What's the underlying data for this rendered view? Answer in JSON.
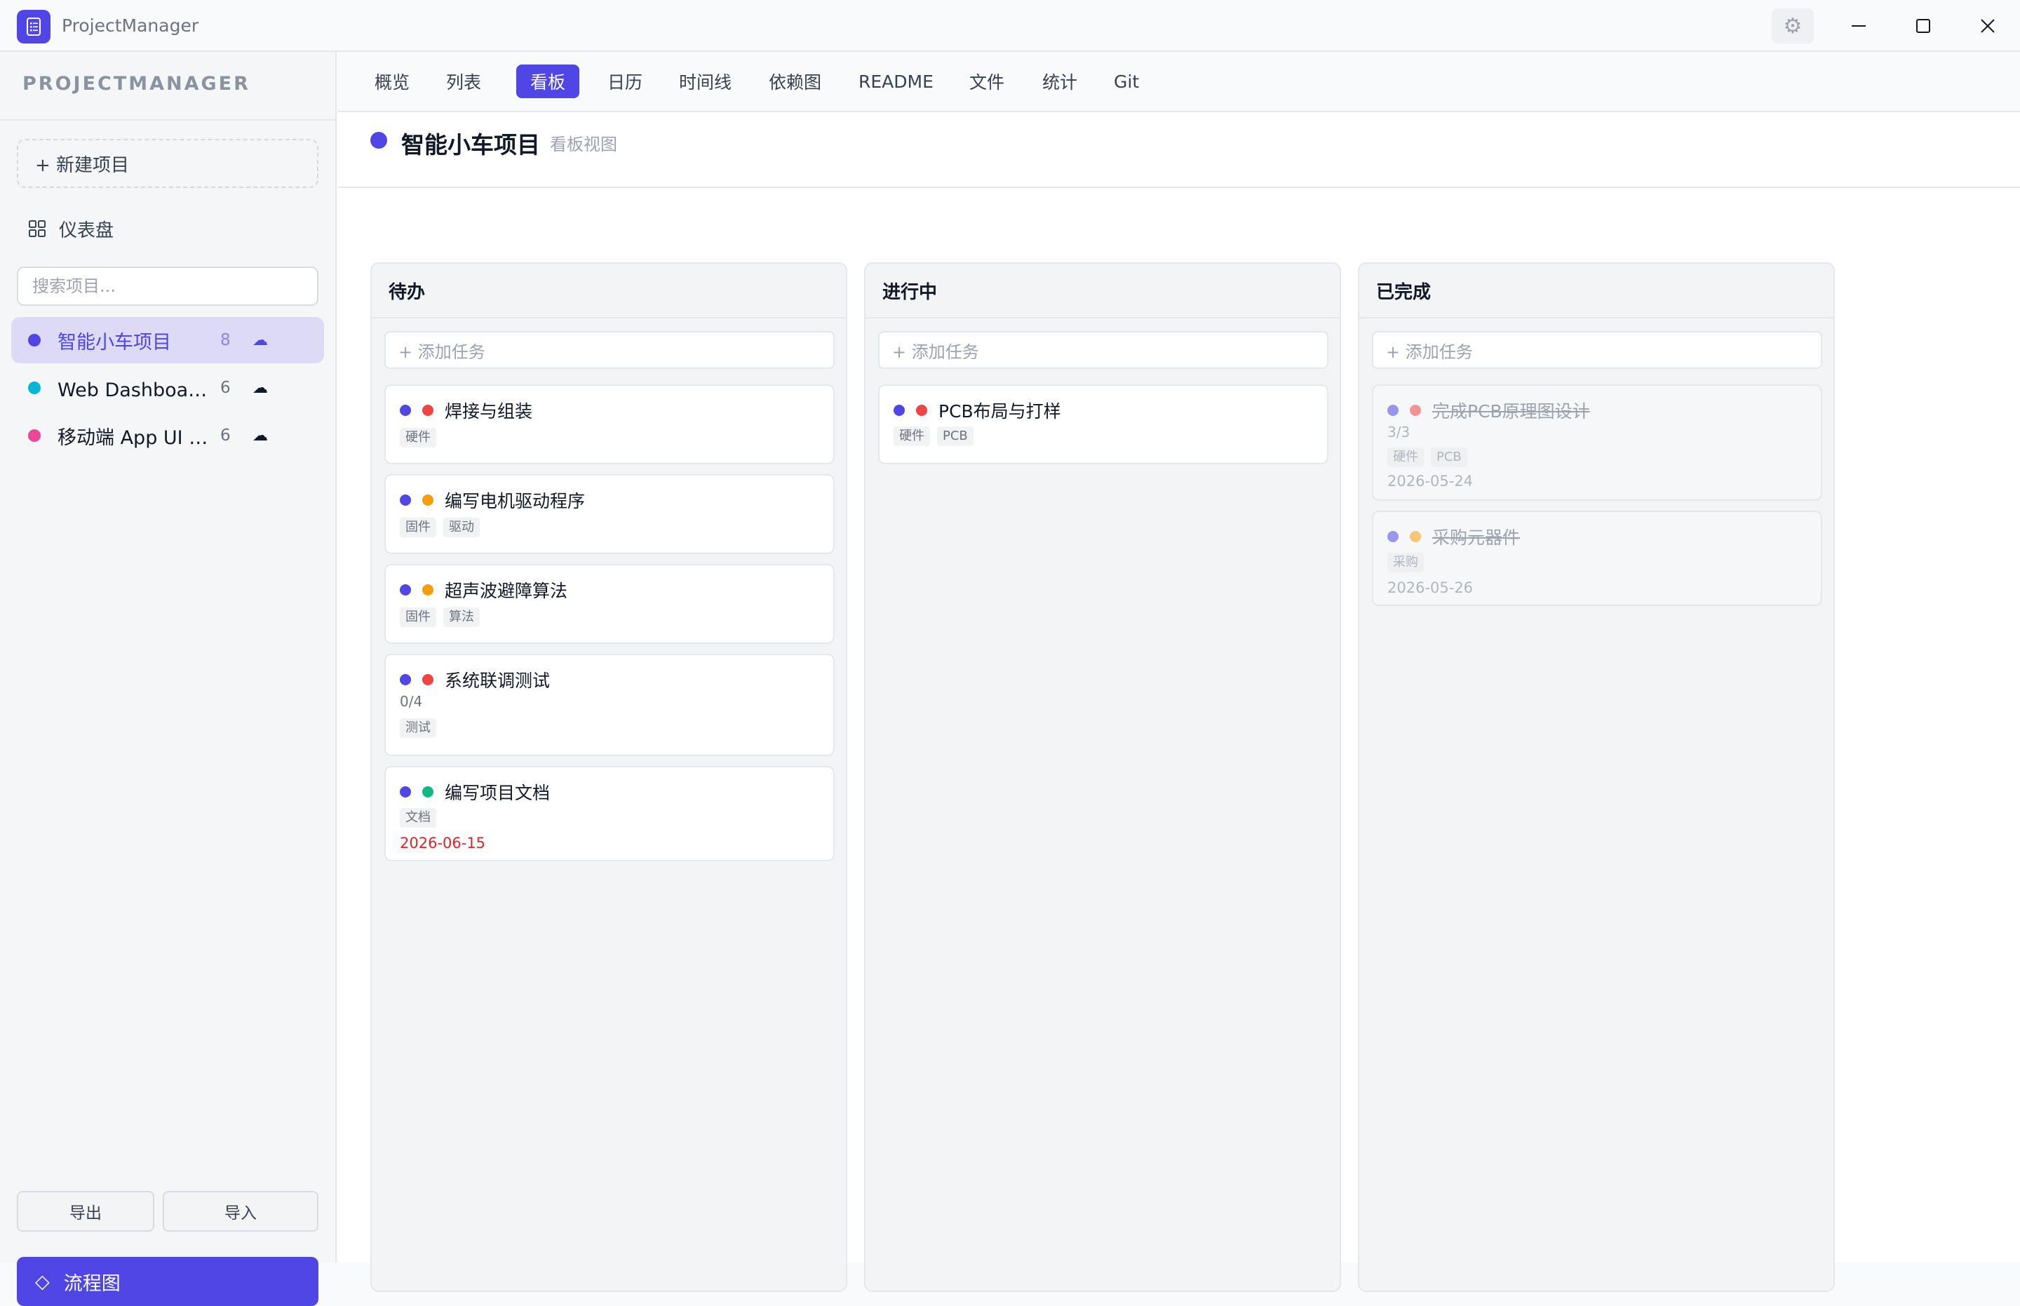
{
  "app": {
    "title": "ProjectManager"
  },
  "window": {
    "settings_icon": "gear-icon",
    "minimize_icon": "minimize-icon",
    "maximize_icon": "maximize-icon",
    "close_icon": "close-icon"
  },
  "sidebar": {
    "brand": "PROJECTMANAGER",
    "new_project": "+ 新建项目",
    "dashboard": "仪表盘",
    "search_placeholder": "搜索项目...",
    "projects": [
      {
        "name": "智能小车项目",
        "count": "8",
        "color": "#4f46e5",
        "active": true
      },
      {
        "name": "Web Dashboard 重构",
        "count": "6",
        "color": "#06b6d4",
        "active": false
      },
      {
        "name": "移动端 App UI 设计",
        "count": "6",
        "color": "#ec4899",
        "active": false
      }
    ],
    "export": "导出",
    "import": "导入",
    "flow": "流程图"
  },
  "tabs": [
    "概览",
    "列表",
    "看板",
    "日历",
    "时间线",
    "依赖图",
    "README",
    "文件",
    "统计",
    "Git"
  ],
  "active_tab": "看板",
  "header": {
    "title": "智能小车项目",
    "subtitle": "看板视图",
    "color": "#4f46e5"
  },
  "board": {
    "add_task": "+ 添加任务",
    "columns": [
      {
        "title": "待办",
        "cards": [
          {
            "title": "焊接与组装",
            "priority_color": "#ef4444",
            "tags": [
              "硬件"
            ]
          },
          {
            "title": "编写电机驱动程序",
            "priority_color": "#f59e0b",
            "tags": [
              "固件",
              "驱动"
            ]
          },
          {
            "title": "超声波避障算法",
            "priority_color": "#f59e0b",
            "tags": [
              "固件",
              "算法"
            ]
          },
          {
            "title": "系统联调测试",
            "priority_color": "#ef4444",
            "progress": "0/4",
            "tags": [
              "测试"
            ]
          },
          {
            "title": "编写项目文档",
            "priority_color": "#10b981",
            "tags": [
              "文档"
            ],
            "due": "2026-06-15"
          }
        ]
      },
      {
        "title": "进行中",
        "cards": [
          {
            "title": "PCB布局与打样",
            "priority_color": "#ef4444",
            "tags": [
              "硬件",
              "PCB"
            ]
          }
        ]
      },
      {
        "title": "已完成",
        "cards": [
          {
            "title": "完成PCB原理图设计",
            "priority_color": "#ef4444",
            "progress": "3/3",
            "tags": [
              "硬件",
              "PCB"
            ],
            "due": "2026-05-24"
          },
          {
            "title": "采购元器件",
            "priority_color": "#f59e0b",
            "tags": [
              "采购"
            ],
            "due": "2026-05-26"
          }
        ]
      }
    ]
  }
}
